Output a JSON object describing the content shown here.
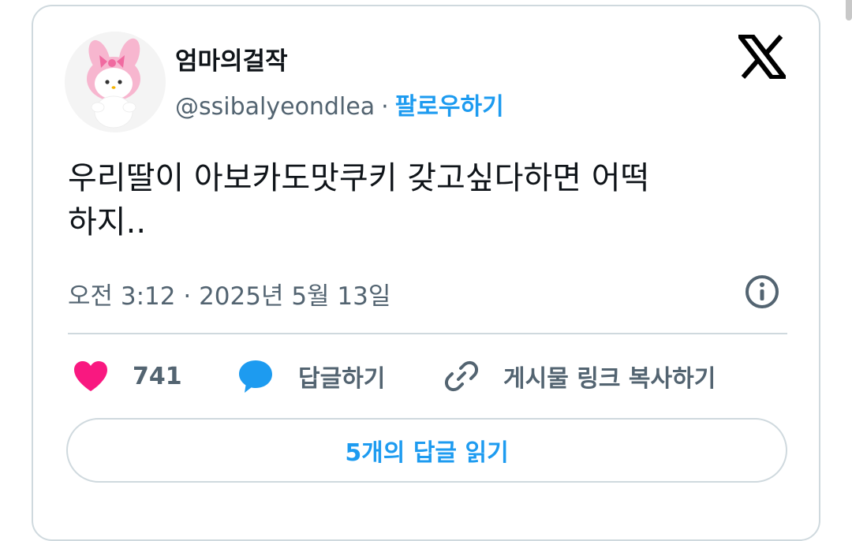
{
  "author": {
    "display_name": "엄마의걸작",
    "handle": "@ssibalyeondlea",
    "separator": "·",
    "follow_label": "팔로우하기",
    "avatar_icon": "pink-rabbit-plush-avatar"
  },
  "brand": {
    "logo_icon": "x-logo-icon"
  },
  "tweet": {
    "text": "우리딸이 아보카도맛쿠키 갖고싶다하면 어떡\n하지..",
    "timestamp": "오전 3:12 · 2025년 5월 13일"
  },
  "actions": {
    "like_count": "741",
    "reply_label": "답글하기",
    "copy_link_label": "게시물 링크 복사하기"
  },
  "read_replies_label": "5개의 답글 읽기",
  "colors": {
    "accent": "#1d9bf0",
    "heart": "#f91880",
    "text": "#0f1419",
    "muted": "#536471",
    "border": "#cfd9de"
  }
}
